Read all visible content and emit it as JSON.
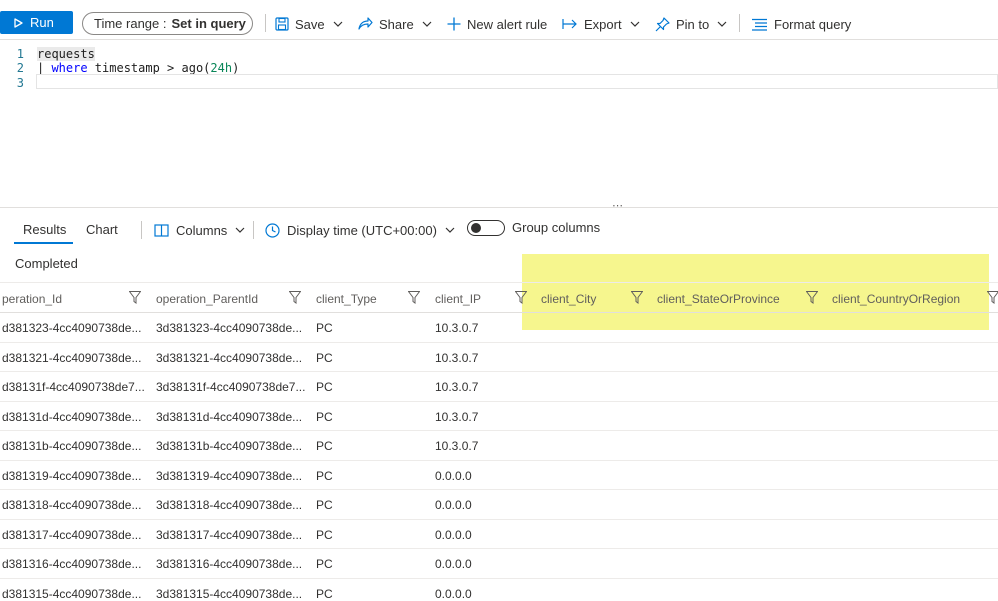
{
  "toolbar": {
    "run_label": "Run",
    "time_range_label": "Time range :",
    "time_range_value": "Set in query",
    "save_label": "Save",
    "share_label": "Share",
    "new_alert_label": "New alert rule",
    "export_label": "Export",
    "pin_label": "Pin to",
    "format_label": "Format query"
  },
  "editor": {
    "line_numbers": [
      "1",
      "2",
      "3"
    ],
    "line1": "requests",
    "line2_pipe": "| ",
    "line2_kw": "where",
    "line2_mid": " timestamp > ago(",
    "line2_num": "24h",
    "line2_end": ")"
  },
  "splitter_grip": "⋯",
  "results": {
    "tab_results": "Results",
    "tab_chart": "Chart",
    "columns_label": "Columns",
    "display_time_label": "Display time (UTC+00:00)",
    "group_columns_label": "Group columns",
    "status": "Completed"
  },
  "grid": {
    "headers": [
      "peration_Id",
      "operation_ParentId",
      "client_Type",
      "client_IP",
      "client_City",
      "client_StateOrProvince",
      "client_CountryOrRegion"
    ],
    "rows": [
      [
        "d381323-4cc4090738de...",
        "3d381323-4cc4090738de...",
        "PC",
        "10.3.0.7"
      ],
      [
        "d381321-4cc4090738de...",
        "3d381321-4cc4090738de...",
        "PC",
        "10.3.0.7"
      ],
      [
        "d38131f-4cc4090738de7...",
        "3d38131f-4cc4090738de7...",
        "PC",
        "10.3.0.7"
      ],
      [
        "d38131d-4cc4090738de...",
        "3d38131d-4cc4090738de...",
        "PC",
        "10.3.0.7"
      ],
      [
        "d38131b-4cc4090738de...",
        "3d38131b-4cc4090738de...",
        "PC",
        "10.3.0.7"
      ],
      [
        "d381319-4cc4090738de...",
        "3d381319-4cc4090738de...",
        "PC",
        "0.0.0.0"
      ],
      [
        "d381318-4cc4090738de...",
        "3d381318-4cc4090738de...",
        "PC",
        "0.0.0.0"
      ],
      [
        "d381317-4cc4090738de...",
        "3d381317-4cc4090738de...",
        "PC",
        "0.0.0.0"
      ],
      [
        "d381316-4cc4090738de...",
        "3d381316-4cc4090738de...",
        "PC",
        "0.0.0.0"
      ],
      [
        "d381315-4cc4090738de...",
        "3d381315-4cc4090738de...",
        "PC",
        "0.0.0.0"
      ]
    ]
  },
  "colors": {
    "accent": "#0078d4",
    "highlight": "#f5f57a",
    "keyword": "#0000ff",
    "number": "#098658"
  }
}
